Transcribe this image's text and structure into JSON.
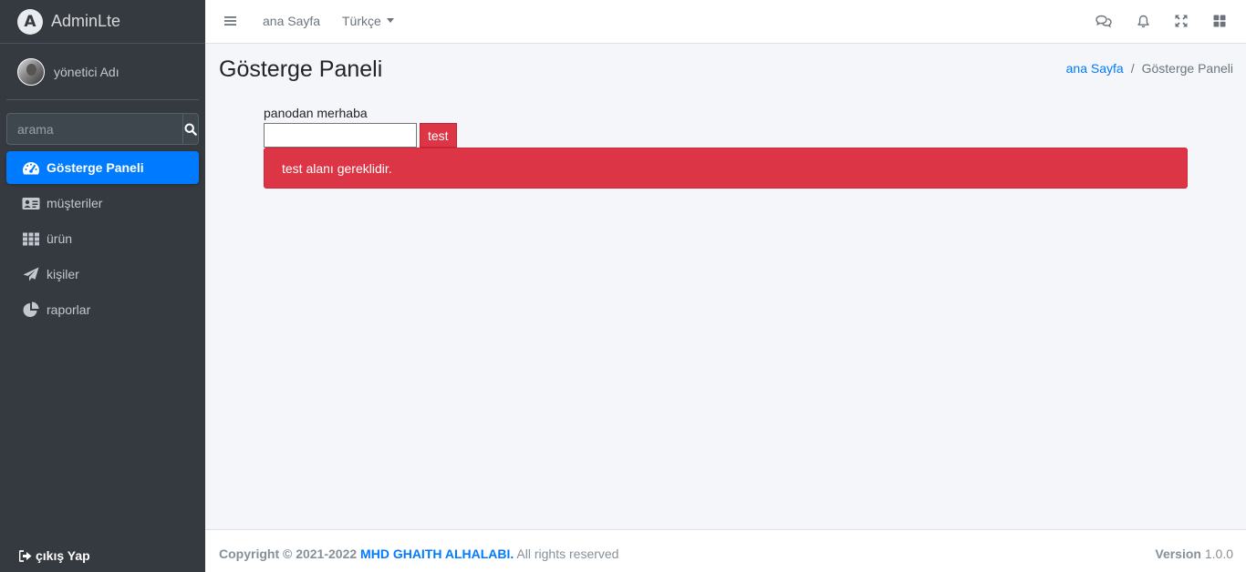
{
  "brand": {
    "name": "AdminLte",
    "logo_letter": "A"
  },
  "user": {
    "name": "yönetici Adı"
  },
  "search": {
    "placeholder": "arama"
  },
  "sidebar": {
    "items": [
      {
        "label": "Gösterge Paneli",
        "icon": "tachometer-icon",
        "active": true
      },
      {
        "label": "müşteriler",
        "icon": "id-card-icon",
        "active": false
      },
      {
        "label": "ürün",
        "icon": "table-grid-icon",
        "active": false
      },
      {
        "label": "kişiler",
        "icon": "paper-plane-icon",
        "active": false
      },
      {
        "label": "raporlar",
        "icon": "pie-chart-icon",
        "active": false
      }
    ],
    "logout": "çıkış Yap"
  },
  "topbar": {
    "home": "ana Sayfa",
    "language": "Türkçe"
  },
  "page": {
    "title": "Gösterge Paneli",
    "breadcrumb": {
      "home": "ana Sayfa",
      "separator": "/",
      "current": "Gösterge Paneli"
    }
  },
  "form": {
    "label": "panodan merhaba",
    "input_value": "",
    "button": "test",
    "error": "test alanı gereklidir."
  },
  "footer": {
    "copyright": "Copyright © 2021-2022",
    "author": "MHD GHAITH ALHALABI.",
    "rights": "All rights reserved",
    "version_label": "Version",
    "version": "1.0.0"
  },
  "colors": {
    "sidebar_bg": "#343a40",
    "accent": "#007bff",
    "danger": "#dc3545",
    "content_bg": "#f4f6f9"
  }
}
